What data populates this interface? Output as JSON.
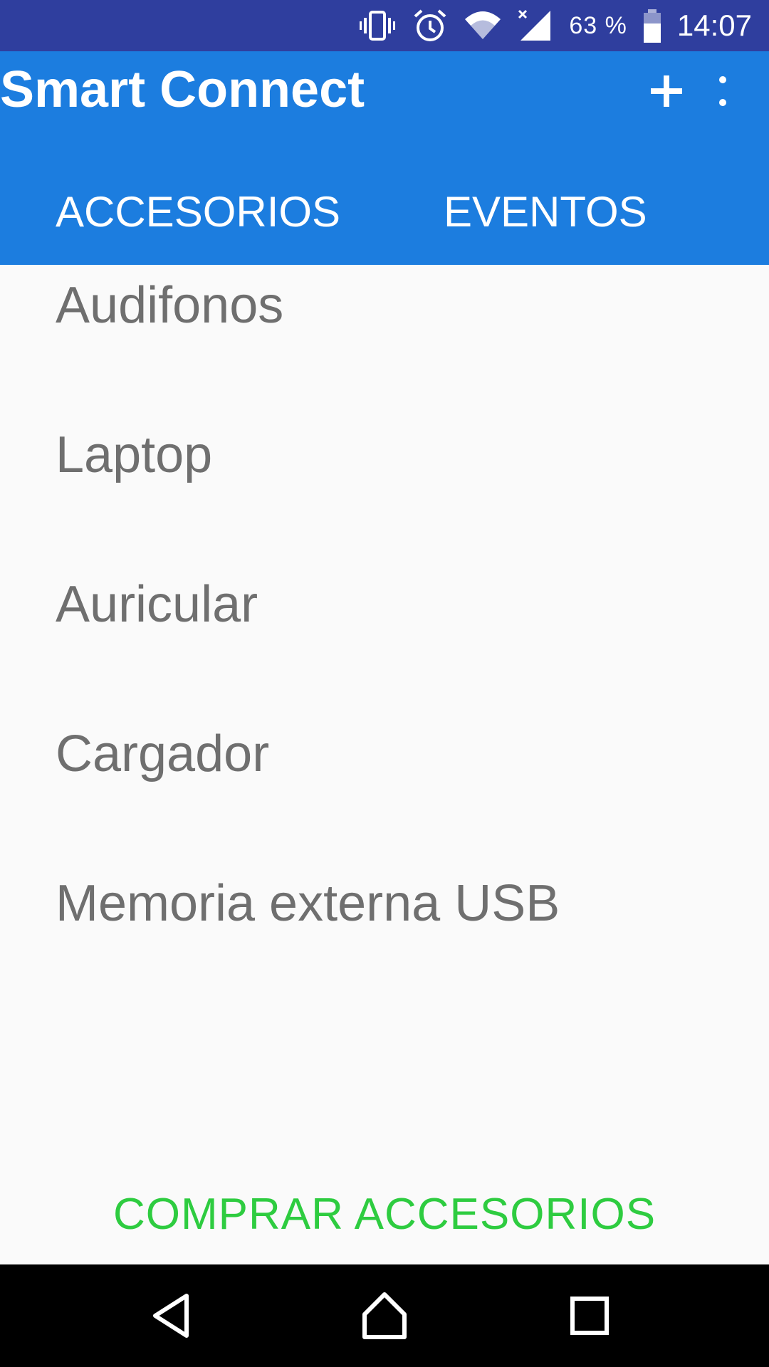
{
  "status_bar": {
    "battery_percent": "63 %",
    "time": "14:07",
    "icons": [
      "vibrate-icon",
      "alarm-icon",
      "wifi-icon",
      "signal-icon",
      "battery-icon"
    ]
  },
  "app_bar": {
    "title": "Smart Connect",
    "actions": [
      "add-icon",
      "more-vert-icon"
    ],
    "color": "#1c7ddf"
  },
  "tabs": [
    {
      "label": "ACCESORIOS",
      "selected": true
    },
    {
      "label": "EVENTOS",
      "selected": false
    }
  ],
  "accessories": [
    {
      "label": "Audifonos"
    },
    {
      "label": "Laptop"
    },
    {
      "label": "Auricular"
    },
    {
      "label": "Cargador"
    },
    {
      "label": "Memoria externa USB"
    }
  ],
  "footer": {
    "buy_label": "COMPRAR ACCESORIOS",
    "buy_color": "#2ecc40"
  },
  "nav_bar": {
    "icons": [
      "back-icon",
      "home-icon",
      "recent-apps-icon"
    ]
  }
}
